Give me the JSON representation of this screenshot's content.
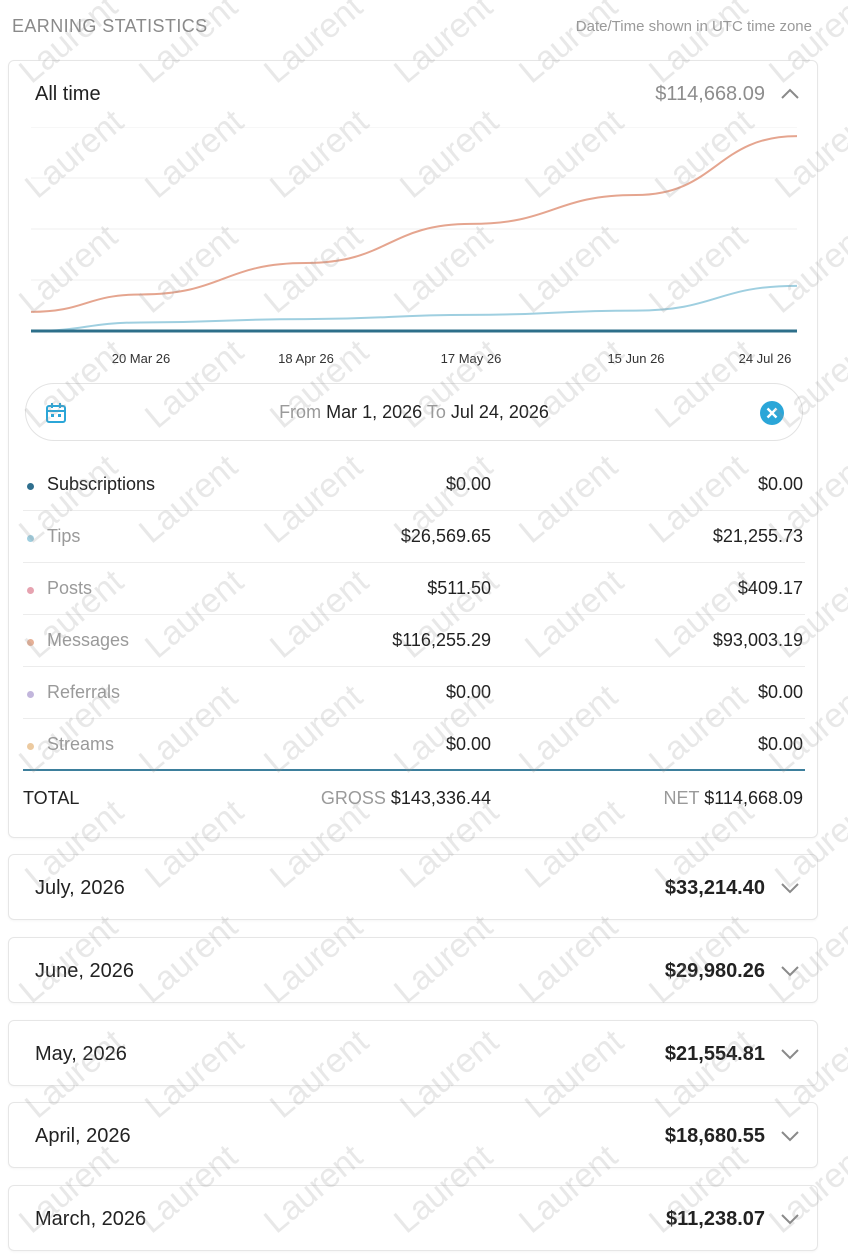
{
  "header": {
    "title": "EARNING STATISTICS",
    "timezone_note": "Date/Time shown in UTC time zone"
  },
  "summary": {
    "label": "All time",
    "amount": "$114,668.09"
  },
  "chart_data": {
    "type": "line",
    "x_tick_labels": [
      "20 Mar 26",
      "18 Apr 26",
      "17 May 26",
      "15 Jun 26",
      "24 Jul 26"
    ],
    "x": [
      "1 Mar 26",
      "20 Mar 26",
      "18 Apr 26",
      "17 May 26",
      "15 Jun 26",
      "24 Jul 26"
    ],
    "series": [
      {
        "color": "#e5a58f",
        "values": [
          11238,
          21500,
          40000,
          63000,
          80000,
          114668
        ]
      },
      {
        "color": "#9fcfe0",
        "values": [
          0,
          5000,
          7000,
          9500,
          12000,
          26570
        ]
      },
      {
        "color": "#2d6f8a",
        "values": [
          0,
          0,
          0,
          0,
          0,
          0
        ]
      }
    ],
    "grid": true
  },
  "range": {
    "from_label": "From",
    "from_value": "Mar 1, 2026",
    "to_label": "To",
    "to_value": "Jul 24, 2026"
  },
  "breakdown": [
    {
      "name": "Subscriptions",
      "gross": "$0.00",
      "net": "$0.00",
      "color": "#2f6f8e"
    },
    {
      "name": "Tips",
      "gross": "$26,569.65",
      "net": "$21,255.73",
      "color": "#9fcfe0"
    },
    {
      "name": "Posts",
      "gross": "$511.50",
      "net": "$409.17",
      "color": "#e6a3b0"
    },
    {
      "name": "Messages",
      "gross": "$116,255.29",
      "net": "$93,003.19",
      "color": "#e6b096"
    },
    {
      "name": "Referrals",
      "gross": "$0.00",
      "net": "$0.00",
      "color": "#c2b6dc"
    },
    {
      "name": "Streams",
      "gross": "$0.00",
      "net": "$0.00",
      "color": "#eccaa0"
    }
  ],
  "total": {
    "label": "TOTAL",
    "gross_label": "GROSS",
    "gross_value": "$143,336.44",
    "net_label": "NET",
    "net_value": "$114,668.09"
  },
  "months": [
    {
      "label": "July, 2026",
      "amount": "$33,214.40"
    },
    {
      "label": "June, 2026",
      "amount": "$29,980.26"
    },
    {
      "label": "May, 2026",
      "amount": "$21,554.81"
    },
    {
      "label": "April, 2026",
      "amount": "$18,680.55"
    },
    {
      "label": "March, 2026",
      "amount": "$11,238.07"
    }
  ],
  "watermark": "Laurent",
  "colors": {
    "accent": "#2ba6d8",
    "divider": "#3d7f9c"
  }
}
